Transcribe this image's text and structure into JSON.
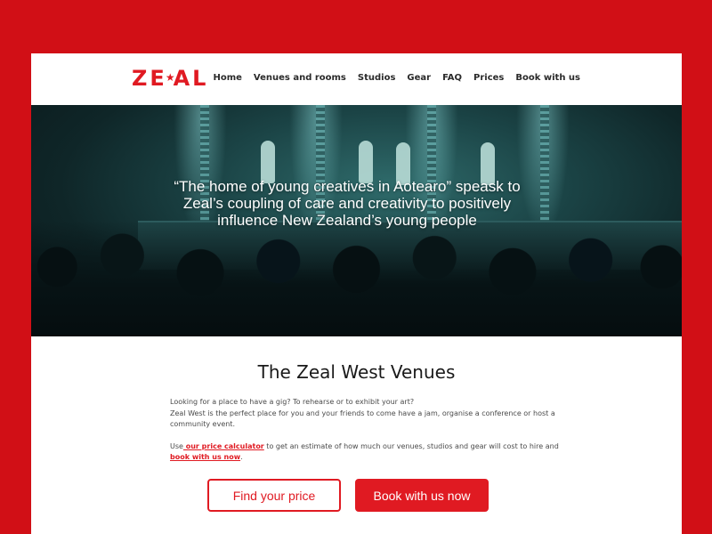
{
  "brand": {
    "logo_left": "Z",
    "logo_star": "★",
    "logo_right": "AL",
    "accent_color": "#e01a22",
    "frame_color": "#d10f16"
  },
  "nav": {
    "items": [
      {
        "label": "Home"
      },
      {
        "label": "Venues and rooms"
      },
      {
        "label": "Studios"
      },
      {
        "label": "Gear"
      },
      {
        "label": "FAQ"
      },
      {
        "label": "Prices"
      },
      {
        "label": "Book with us"
      }
    ]
  },
  "hero": {
    "quote": "“The home of young creatives in Aotearo” speask to Zeal’s coupling of care and creativity to positively influence New Zealand’s young people"
  },
  "main": {
    "title": "The Zeal West Venues",
    "para1_line1": "Looking for a place to have a gig? To rehearse or to exhibit your art?",
    "para1_line2": "Zeal West is the perfect place for you and your friends to come have a jam, organise  a conference or host a community event.",
    "para2_prefix": "Use",
    "price_calc_link": " our price calculator",
    "para2_middle": " to get an estimate of how much our venues, studios and gear will cost to hire and",
    "book_link": "book with us now",
    "para2_suffix": ".",
    "find_price_button": "Find your price",
    "book_now_button": "Book with us now"
  }
}
